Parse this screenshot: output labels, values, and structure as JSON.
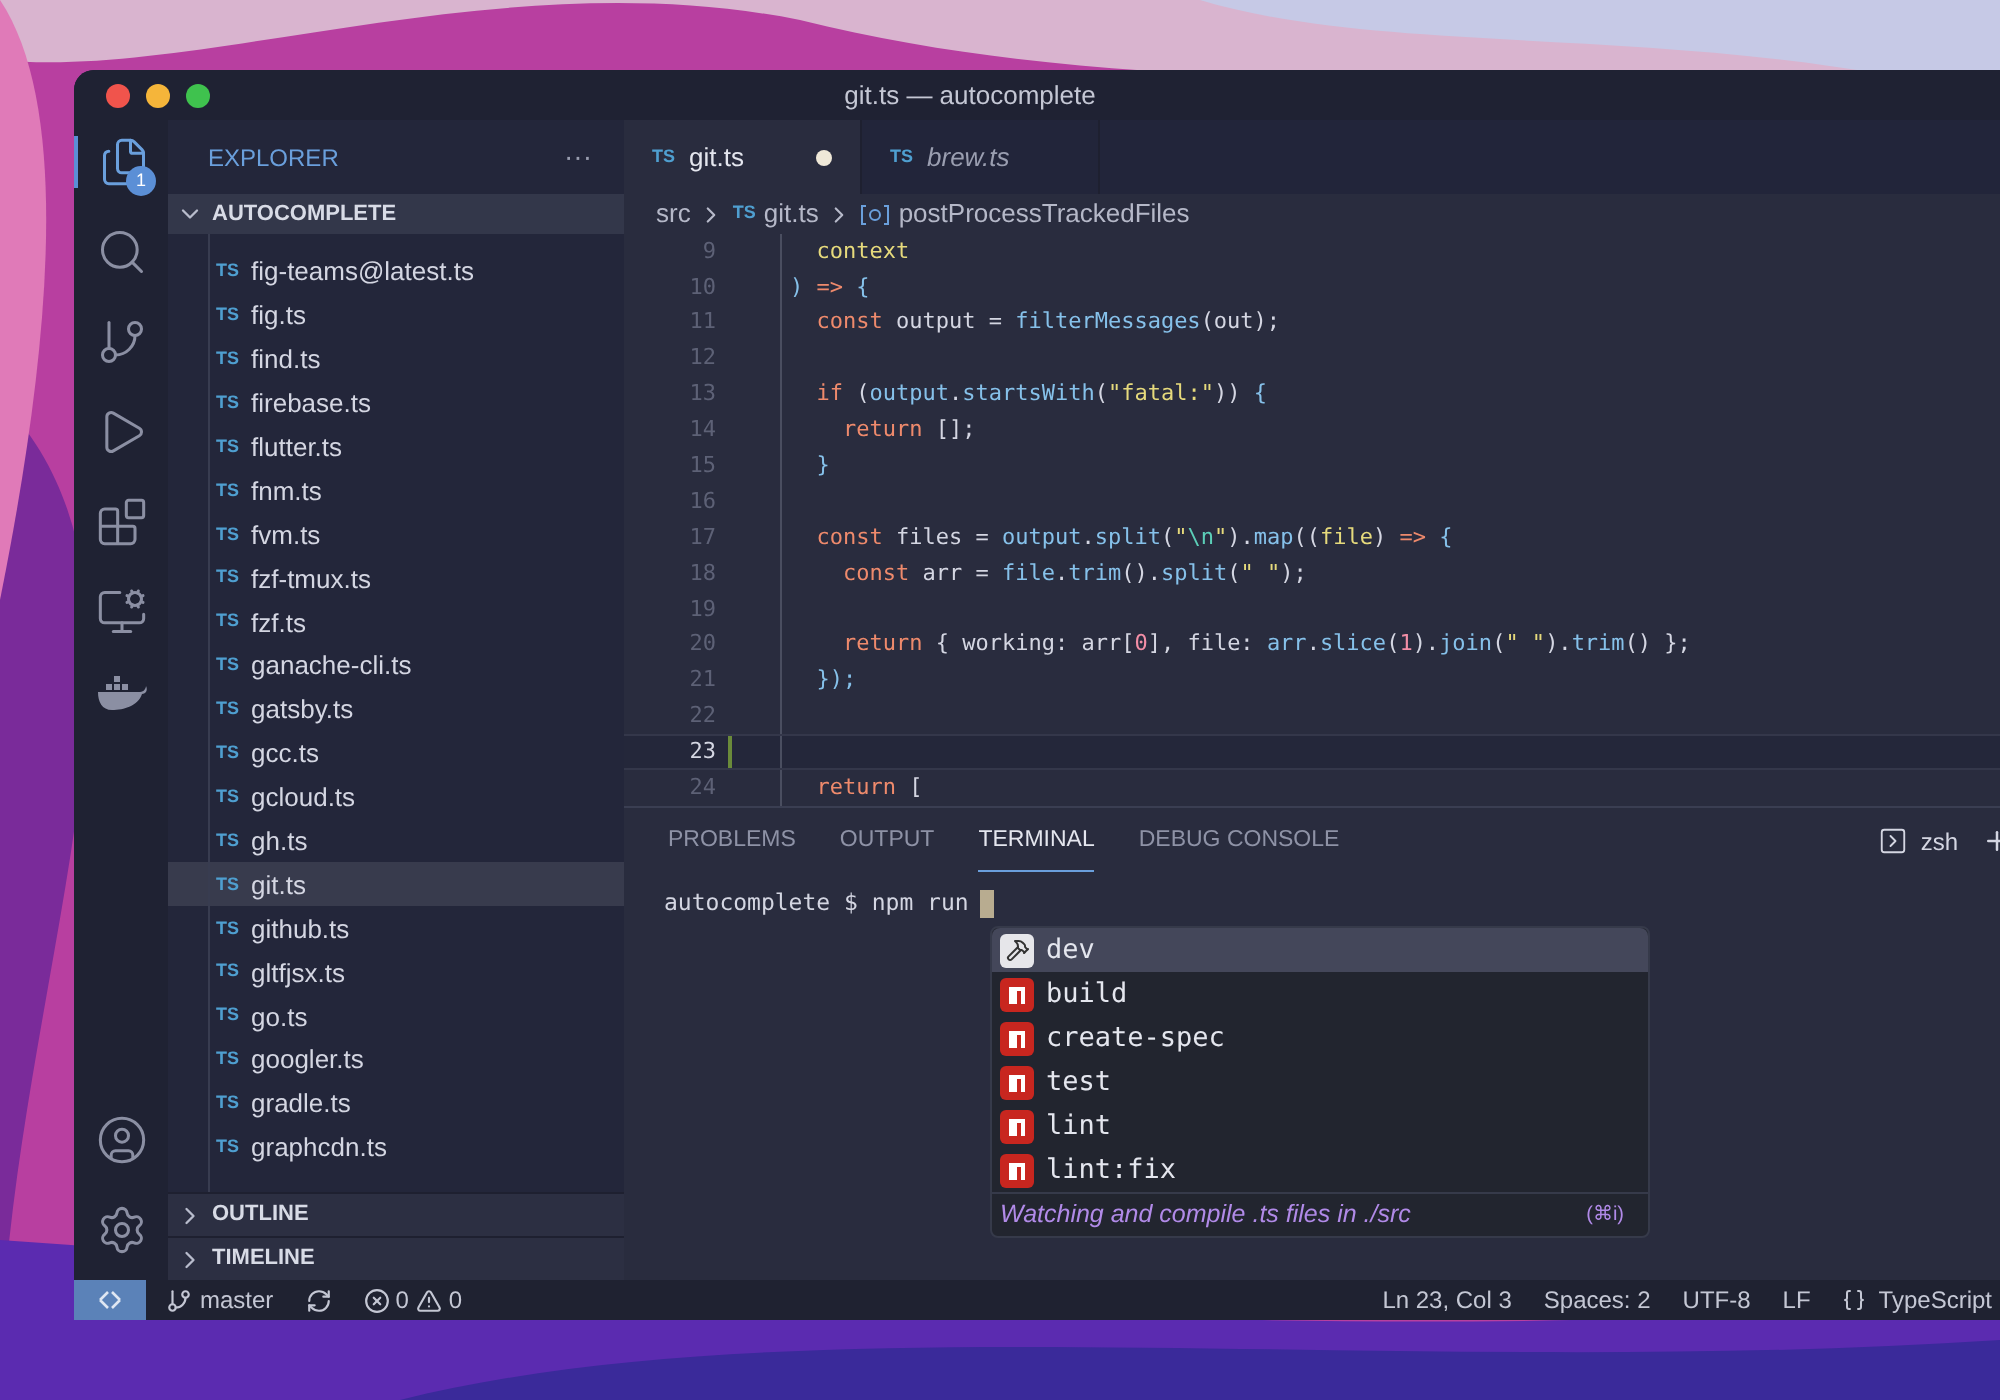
{
  "window": {
    "title": "git.ts — autocomplete"
  },
  "activity_bar": {
    "explorer_badge": "1"
  },
  "explorer": {
    "title": "EXPLORER",
    "more": "···",
    "root": {
      "label": "AUTOCOMPLETE",
      "expanded": true,
      "children": [
        {
          "label": "fig-teams@latest.ts",
          "badge": "TS",
          "selected": false
        },
        {
          "label": "fig.ts",
          "badge": "TS",
          "selected": false
        },
        {
          "label": "find.ts",
          "badge": "TS",
          "selected": false
        },
        {
          "label": "firebase.ts",
          "badge": "TS",
          "selected": false
        },
        {
          "label": "flutter.ts",
          "badge": "TS",
          "selected": false
        },
        {
          "label": "fnm.ts",
          "badge": "TS",
          "selected": false
        },
        {
          "label": "fvm.ts",
          "badge": "TS",
          "selected": false
        },
        {
          "label": "fzf-tmux.ts",
          "badge": "TS",
          "selected": false
        },
        {
          "label": "fzf.ts",
          "badge": "TS",
          "selected": false
        },
        {
          "label": "ganache-cli.ts",
          "badge": "TS",
          "selected": false
        },
        {
          "label": "gatsby.ts",
          "badge": "TS",
          "selected": false
        },
        {
          "label": "gcc.ts",
          "badge": "TS",
          "selected": false
        },
        {
          "label": "gcloud.ts",
          "badge": "TS",
          "selected": false
        },
        {
          "label": "gh.ts",
          "badge": "TS",
          "selected": false
        },
        {
          "label": "git.ts",
          "badge": "TS",
          "selected": true
        },
        {
          "label": "github.ts",
          "badge": "TS",
          "selected": false
        },
        {
          "label": "gltfjsx.ts",
          "badge": "TS",
          "selected": false
        },
        {
          "label": "go.ts",
          "badge": "TS",
          "selected": false
        },
        {
          "label": "googler.ts",
          "badge": "TS",
          "selected": false
        },
        {
          "label": "gradle.ts",
          "badge": "TS",
          "selected": false
        },
        {
          "label": "graphcdn.ts",
          "badge": "TS",
          "selected": false
        }
      ]
    },
    "sections": [
      {
        "label": "OUTLINE",
        "expanded": false
      },
      {
        "label": "TIMELINE",
        "expanded": false
      }
    ]
  },
  "tabs": [
    {
      "label": "git.ts",
      "badge": "TS",
      "selected": true,
      "dirty": true,
      "preview": false
    },
    {
      "label": "brew.ts",
      "badge": "TS",
      "selected": false,
      "dirty": false,
      "preview": true
    }
  ],
  "breadcrumb": {
    "folder": "src",
    "file_badge": "TS",
    "file": "git.ts",
    "symbol": "postProcessTrackedFiles"
  },
  "code": [
    {
      "number": "9",
      "current": false,
      "tokens": [
        {
          "kind": "param",
          "text": "  context"
        }
      ]
    },
    {
      "number": "10",
      "current": false,
      "tokens": [
        {
          "kind": "punct",
          "text": ")"
        },
        {
          "kind": "keyword",
          "text": " =>"
        },
        {
          "kind": "punct",
          "text": " {"
        }
      ]
    },
    {
      "number": "11",
      "current": false,
      "tokens": [
        {
          "kind": "keyword",
          "text": "  const"
        },
        {
          "kind": "plain",
          "text": " output = "
        },
        {
          "kind": "function",
          "text": "filterMessages"
        },
        {
          "kind": "plain",
          "text": "(out);"
        }
      ]
    },
    {
      "number": "12",
      "current": false
    },
    {
      "number": "13",
      "current": false,
      "tokens": [
        {
          "kind": "keyword",
          "text": "  if"
        },
        {
          "kind": "plain",
          "text": " ("
        },
        {
          "kind": "function",
          "text": "output"
        },
        {
          "kind": "plain",
          "text": "."
        },
        {
          "kind": "function",
          "text": "startsWith"
        },
        {
          "kind": "plain",
          "text": "("
        },
        {
          "kind": "string",
          "text": "\"fatal:\""
        },
        {
          "kind": "plain",
          "text": ")) "
        },
        {
          "kind": "punct",
          "text": "{"
        }
      ]
    },
    {
      "number": "14",
      "current": false,
      "tokens": [
        {
          "kind": "keyword",
          "text": "    return"
        },
        {
          "kind": "plain",
          "text": " [];"
        }
      ]
    },
    {
      "number": "15",
      "current": false,
      "tokens": [
        {
          "kind": "punct",
          "text": "  }"
        }
      ]
    },
    {
      "number": "16",
      "current": false
    },
    {
      "number": "17",
      "current": false,
      "tokens": [
        {
          "kind": "keyword",
          "text": "  const"
        },
        {
          "kind": "plain",
          "text": " files = "
        },
        {
          "kind": "function",
          "text": "output"
        },
        {
          "kind": "plain",
          "text": "."
        },
        {
          "kind": "function",
          "text": "split"
        },
        {
          "kind": "plain",
          "text": "("
        },
        {
          "kind": "string",
          "text": "\""
        },
        {
          "kind": "escape",
          "text": "\\n"
        },
        {
          "kind": "string",
          "text": "\""
        },
        {
          "kind": "plain",
          "text": ")."
        },
        {
          "kind": "function",
          "text": "map"
        },
        {
          "kind": "plain",
          "text": "(("
        },
        {
          "kind": "param",
          "text": "file"
        },
        {
          "kind": "plain",
          "text": ")"
        },
        {
          "kind": "keyword",
          "text": " =>"
        },
        {
          "kind": "punct",
          "text": " {"
        }
      ]
    },
    {
      "number": "18",
      "current": false,
      "tokens": [
        {
          "kind": "keyword",
          "text": "    const"
        },
        {
          "kind": "plain",
          "text": " arr = "
        },
        {
          "kind": "function",
          "text": "file"
        },
        {
          "kind": "plain",
          "text": "."
        },
        {
          "kind": "function",
          "text": "trim"
        },
        {
          "kind": "plain",
          "text": "()."
        },
        {
          "kind": "function",
          "text": "split"
        },
        {
          "kind": "plain",
          "text": "("
        },
        {
          "kind": "string",
          "text": "\" \""
        },
        {
          "kind": "plain",
          "text": ");"
        }
      ]
    },
    {
      "number": "19",
      "current": false
    },
    {
      "number": "20",
      "current": false,
      "tokens": [
        {
          "kind": "keyword",
          "text": "    return"
        },
        {
          "kind": "plain",
          "text": " { working: arr["
        },
        {
          "kind": "number",
          "text": "0"
        },
        {
          "kind": "plain",
          "text": "], file: "
        },
        {
          "kind": "function",
          "text": "arr"
        },
        {
          "kind": "plain",
          "text": "."
        },
        {
          "kind": "function",
          "text": "slice"
        },
        {
          "kind": "plain",
          "text": "("
        },
        {
          "kind": "number",
          "text": "1"
        },
        {
          "kind": "plain",
          "text": ")."
        },
        {
          "kind": "function",
          "text": "join"
        },
        {
          "kind": "plain",
          "text": "("
        },
        {
          "kind": "string",
          "text": "\" \""
        },
        {
          "kind": "plain",
          "text": ")."
        },
        {
          "kind": "function",
          "text": "trim"
        },
        {
          "kind": "plain",
          "text": "() };"
        }
      ]
    },
    {
      "number": "21",
      "current": false,
      "tokens": [
        {
          "kind": "punct",
          "text": "  });"
        }
      ]
    },
    {
      "number": "22",
      "current": false
    },
    {
      "number": "23",
      "current": true
    },
    {
      "number": "24",
      "current": false,
      "tokens": [
        {
          "kind": "keyword",
          "text": "  return"
        },
        {
          "kind": "plain",
          "text": " ["
        }
      ]
    }
  ],
  "panel": {
    "tabs": [
      {
        "label": "PROBLEMS",
        "selected": false
      },
      {
        "label": "OUTPUT",
        "selected": false
      },
      {
        "label": "TERMINAL",
        "selected": true
      },
      {
        "label": "DEBUG CONSOLE",
        "selected": false
      }
    ],
    "shell": "zsh",
    "prompt": "autocomplete $ npm run",
    "suggestions": [
      {
        "label": "dev",
        "kind": "tool",
        "selected": true
      },
      {
        "label": "build",
        "kind": "npm",
        "selected": false
      },
      {
        "label": "create-spec",
        "kind": "npm",
        "selected": false
      },
      {
        "label": "test",
        "kind": "npm",
        "selected": false
      },
      {
        "label": "lint",
        "kind": "npm",
        "selected": false
      },
      {
        "label": "lint:fix",
        "kind": "npm",
        "selected": false
      }
    ],
    "description": "Watching and compile .ts files in ./src",
    "shortcut": "(⌘i)"
  },
  "status_bar": {
    "branch": "master",
    "errors": "0",
    "warnings": "0",
    "position": "Ln 23, Col 3",
    "indent": "Spaces: 2",
    "encoding": "UTF-8",
    "eol": "LF",
    "language": "TypeScript"
  }
}
